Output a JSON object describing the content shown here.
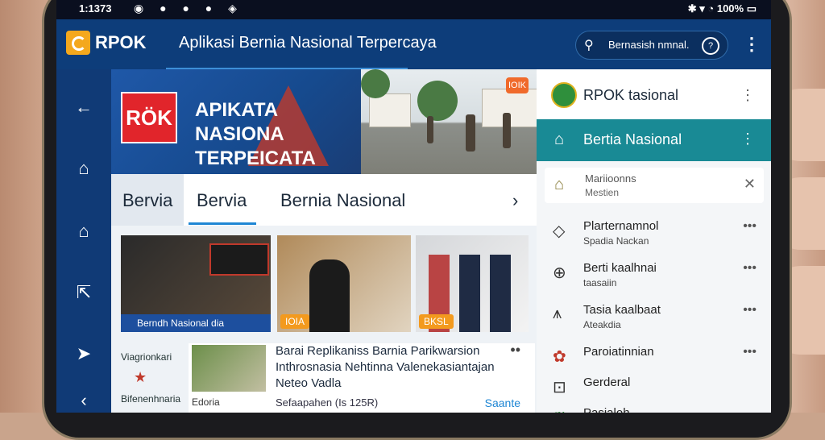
{
  "status_bar": {
    "time": "1:1373",
    "battery": "100%"
  },
  "app_bar": {
    "logo_text": "RPOK",
    "title": "Aplikasi Bernia Nasional Terpercaya",
    "search_text": "Bernasish nmnal.",
    "more_icon": "kebab-menu-icon"
  },
  "nav_rail": {
    "items": [
      "back-arrow-icon",
      "bell-icon",
      "home-icon",
      "share-icon",
      "cast-icon"
    ],
    "bottom_label": "Viagrionkari",
    "bottom_label2": "Bifenenhnaria"
  },
  "hero": {
    "logo": "RÖK",
    "headline": "APIKATA NASIONA TERPEICATA",
    "badge": "IOIK"
  },
  "tabs": {
    "side_label": "Bervia",
    "active": "Bervia",
    "second": "Bernia Nasional"
  },
  "cards": [
    {
      "caption": "Berndh Nasional dia",
      "tag": ""
    },
    {
      "caption": "",
      "tag": "IOIA"
    },
    {
      "caption": "",
      "tag": "BKSL"
    }
  ],
  "article": {
    "title": "Barai Replikaniss Barnia Parikwarsion Inthrosnasia Nehtinna Valenekasiantajan Neteo Vadla",
    "meta": "Sefaapahen (Is 125R)",
    "source": "Edoria",
    "link": "Saante"
  },
  "right_panel": {
    "title": "RPOK tasional",
    "selected": "Bertia Nasional",
    "notification": {
      "line1": "Mariioonns",
      "line2": "Mestien"
    },
    "items": [
      {
        "line1": "Plarternamnol",
        "line2": "Spadia Nackan"
      },
      {
        "line1": "Berti kaalhnai",
        "line2": "taasaiin"
      },
      {
        "line1": "Tasia kaalbaat",
        "line2": "Ateakdia"
      },
      {
        "line1": "Paroiatinnian",
        "line2": ""
      },
      {
        "line1": "Gerderal",
        "line2": ""
      },
      {
        "line1": "Pasialeh",
        "line2": ""
      }
    ]
  },
  "colors": {
    "accent": "#0d3d7a",
    "selected": "#198a95",
    "logo": "#f4a81d",
    "brand_red": "#e1252b"
  }
}
